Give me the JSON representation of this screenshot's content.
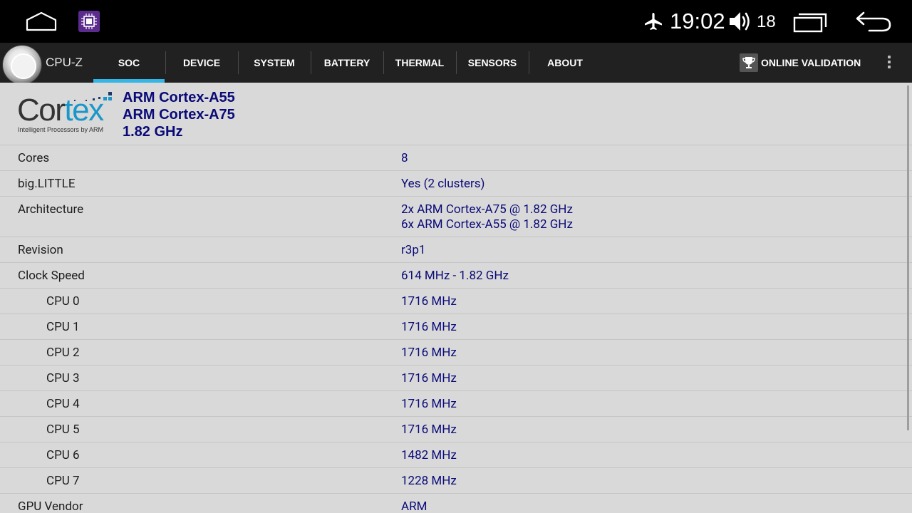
{
  "status_bar": {
    "time": "19:02",
    "volume_level": "18",
    "icons": [
      "home-icon",
      "app-chip-icon",
      "airplane-mode-icon",
      "volume-icon",
      "recent-apps-icon",
      "back-icon"
    ]
  },
  "toolbar": {
    "app_title": "CPU-Z",
    "tabs": [
      {
        "label": "SOC",
        "active": true
      },
      {
        "label": "DEVICE",
        "active": false
      },
      {
        "label": "SYSTEM",
        "active": false
      },
      {
        "label": "BATTERY",
        "active": false
      },
      {
        "label": "THERMAL",
        "active": false
      },
      {
        "label": "SENSORS",
        "active": false
      },
      {
        "label": "ABOUT",
        "active": false
      }
    ],
    "validation_label": "ONLINE VALIDATION"
  },
  "header": {
    "logo_word": "Cortex",
    "logo_tagline": "Intelligent Processors by ARM",
    "line1": "ARM Cortex-A55",
    "line2": "ARM Cortex-A75",
    "line3": "1.82 GHz"
  },
  "rows": [
    {
      "label": "Cores",
      "value": "8"
    },
    {
      "label": "big.LITTLE",
      "value": "Yes (2 clusters)"
    },
    {
      "label": "Architecture",
      "value": "2x ARM Cortex-A75 @ 1.82 GHz",
      "value2": "6x ARM Cortex-A55 @ 1.82 GHz"
    },
    {
      "label": "Revision",
      "value": "r3p1"
    },
    {
      "label": "Clock Speed",
      "value": "614 MHz - 1.82 GHz"
    },
    {
      "label": "CPU 0",
      "value": "1716 MHz"
    },
    {
      "label": "CPU 1",
      "value": "1716 MHz"
    },
    {
      "label": "CPU 2",
      "value": "1716 MHz"
    },
    {
      "label": "CPU 3",
      "value": "1716 MHz"
    },
    {
      "label": "CPU 4",
      "value": "1716 MHz"
    },
    {
      "label": "CPU 5",
      "value": "1716 MHz"
    },
    {
      "label": "CPU 6",
      "value": "1482 MHz"
    },
    {
      "label": "CPU 7",
      "value": "1228 MHz"
    },
    {
      "label": "GPU Vendor",
      "value": "ARM"
    }
  ],
  "colors": {
    "accent": "#33b5e5",
    "value_text": "#0a0a78",
    "toolbar_bg": "#212121",
    "content_bg": "#d9d9d9"
  }
}
